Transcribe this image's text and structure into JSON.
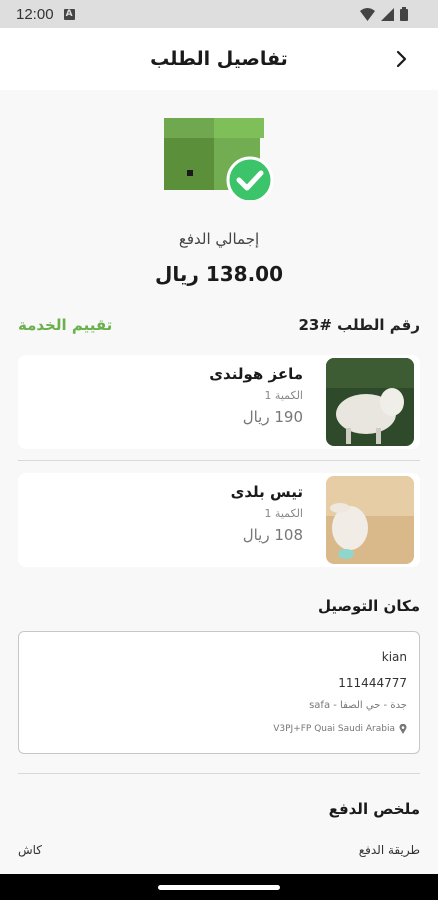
{
  "status_bar": {
    "time": "12:00",
    "badge": "A"
  },
  "header": {
    "title": "تفاصيل الطلب",
    "back_icon": "chevron-right-icon"
  },
  "summary": {
    "total_label": "إجمالي الدفع",
    "total_value": "138.00 ريال"
  },
  "order": {
    "number_label": "رقم الطلب #23",
    "rate_label": "تقييم الخدمة"
  },
  "products": [
    {
      "name": "ماعز هولندى",
      "quantity": "الكمية 1",
      "price": "190 ريال"
    },
    {
      "name": "تيس بلدى",
      "quantity": "الكمية 1",
      "price": "108 ريال"
    }
  ],
  "delivery": {
    "title": "مكان التوصيل",
    "name": "kian",
    "phone": "111444777",
    "area": "جدة - حي الصفا - safa",
    "plus_code": "V3PJ+FP Quai Saudi Arabia"
  },
  "payment": {
    "title": "ملخص الدفع",
    "method_label": "طريقة الدفع",
    "method_value": "كاش"
  },
  "colors": {
    "accent_green": "#6ab04c",
    "box_green": "#5b9e3f",
    "check_green": "#3cc46a"
  }
}
